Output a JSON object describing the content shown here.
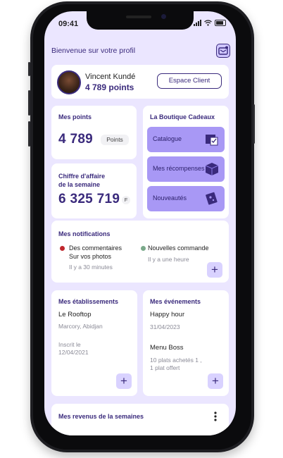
{
  "status": {
    "time": "09:41"
  },
  "header": {
    "title": "Bienvenue sur votre profil"
  },
  "user": {
    "name": "Vincent Kundé",
    "points": "4 789 points",
    "client_button": "Espace Client"
  },
  "points_card": {
    "title": "Mes points",
    "value": "4 789",
    "unit": "Points"
  },
  "revenue_card": {
    "title_line1": "Chiffre d'affaire",
    "title_line2": "de la semaine",
    "value": "6 325 719",
    "unit": "F"
  },
  "shop": {
    "title": "La Boutique Cadeaux",
    "items": [
      {
        "label": "Catalogue",
        "icon": "catalog-box-icon"
      },
      {
        "label": "Mes récompenses",
        "icon": "gift-box-icon"
      },
      {
        "label": "Nouveautés",
        "icon": "new-item-icon"
      }
    ]
  },
  "notifications": {
    "title": "Mes notifications",
    "items": [
      {
        "line1": "Des commentaires",
        "line2": "Sur vos photos",
        "time": "Il y a 30 minutes",
        "color": "#c0272d"
      },
      {
        "line1": "Nouvelles commande",
        "time": "Il y a une heure",
        "color": "#7aa98a"
      }
    ]
  },
  "establishments": {
    "title": "Mes établissements",
    "name": "Le Rooftop",
    "location": "Marcory, Abidjan",
    "registered_label": "Inscrit le",
    "registered_date": "12/04/2021"
  },
  "events": {
    "title": "Mes événements",
    "event1": {
      "name": "Happy hour",
      "date": "31/04/2023"
    },
    "event2": {
      "name": "Menu Boss",
      "line1": "10 plats achetés 1 ,",
      "line2": "1 plat offert"
    }
  },
  "revenues": {
    "title": "Mes revenus de la semaines"
  },
  "colors": {
    "accent": "#3a2a7c",
    "screen_bg": "#ebe6ff",
    "shop_button": "#a898f5"
  }
}
